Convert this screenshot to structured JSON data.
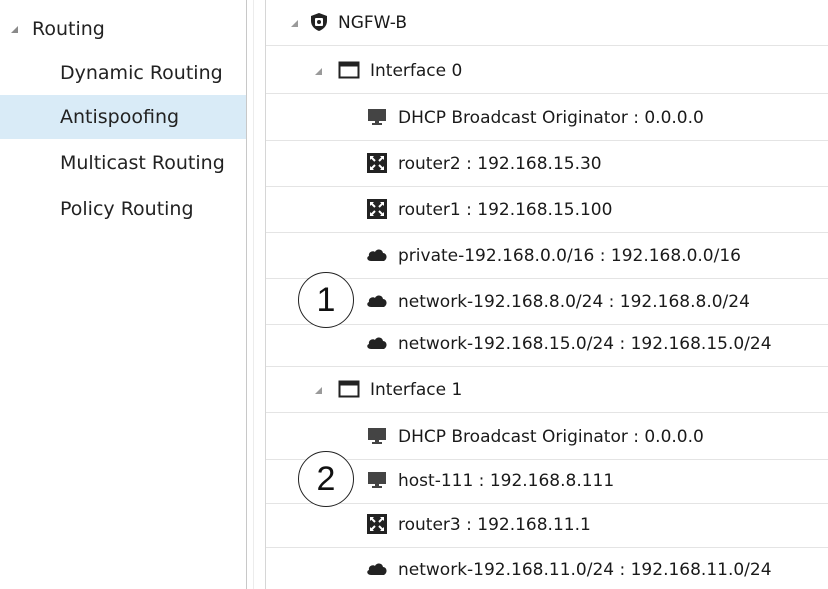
{
  "nav": {
    "section": {
      "label": "Routing",
      "icon": "collapse-triangle-icon"
    },
    "items": [
      {
        "label": "Dynamic Routing",
        "selected": false
      },
      {
        "label": "Antispoofing",
        "selected": true
      },
      {
        "label": "Multicast Routing",
        "selected": false
      },
      {
        "label": "Policy Routing",
        "selected": false
      }
    ],
    "selected_color": "#d9ebf7"
  },
  "tree": {
    "root": {
      "label": "NGFW-B",
      "icon": "firewall-shield-icon"
    },
    "interfaces": [
      {
        "label": "Interface 0",
        "icon": "interface-icon",
        "children": [
          {
            "label": "DHCP Broadcast Originator : 0.0.0.0",
            "icon": "host-icon"
          },
          {
            "label": "router2 : 192.168.15.30",
            "icon": "router-icon"
          },
          {
            "label": "router1 : 192.168.15.100",
            "icon": "router-icon"
          },
          {
            "label": "private-192.168.0.0/16 : 192.168.0.0/16",
            "icon": "network-cloud-icon"
          },
          {
            "label": "network-192.168.8.0/24 : 192.168.8.0/24",
            "icon": "network-cloud-icon"
          },
          {
            "label": "network-192.168.15.0/24 : 192.168.15.0/24",
            "icon": "network-cloud-icon"
          }
        ]
      },
      {
        "label": "Interface 1",
        "icon": "interface-icon",
        "children": [
          {
            "label": "DHCP Broadcast Originator : 0.0.0.0",
            "icon": "host-icon"
          },
          {
            "label": "host-111 : 192.168.8.111",
            "icon": "host-icon"
          },
          {
            "label": "router3 : 192.168.11.1",
            "icon": "router-icon"
          },
          {
            "label": "network-192.168.11.0/24 : 192.168.11.0/24",
            "icon": "network-cloud-icon"
          }
        ]
      }
    ]
  },
  "callouts": [
    "1",
    "2"
  ]
}
